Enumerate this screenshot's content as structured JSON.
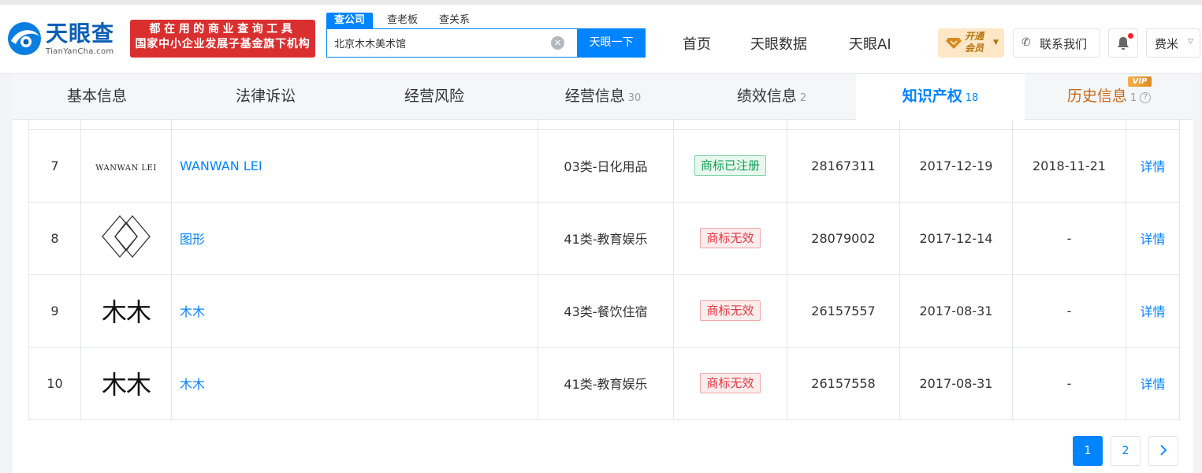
{
  "header": {
    "logo_cn": "天眼查",
    "logo_en": "TianYanCha.com",
    "slogan_line1": "都在用的商业查询工具",
    "slogan_line2": "国家中小企业发展子基金旗下机构",
    "search_tabs": [
      "查公司",
      "查老板",
      "查关系"
    ],
    "search_value": "北京木木美术馆",
    "search_button": "天眼一下",
    "nav": [
      "首页",
      "天眼数据",
      "天眼AI"
    ],
    "vip_line1": "开通",
    "vip_line2": "会员",
    "contact_label": "联系我们",
    "user_label": "费米",
    "colors": {
      "accent": "#0084ff",
      "slogan_bg": "#d9302f",
      "vip_bg": "#fde7c6"
    }
  },
  "tabs": [
    {
      "label": "基本信息",
      "count": ""
    },
    {
      "label": "法律诉讼",
      "count": ""
    },
    {
      "label": "经营风险",
      "count": ""
    },
    {
      "label": "经营信息",
      "count": "30"
    },
    {
      "label": "绩效信息",
      "count": "2"
    },
    {
      "label": "知识产权",
      "count": "18",
      "active": true
    },
    {
      "label": "历史信息",
      "count": "1",
      "badge": "VIP"
    }
  ],
  "trademarks": [
    {
      "num": "7",
      "image_text": "WANWAN LEI",
      "name": "WANWAN LEI",
      "category": "03类-日化用品",
      "status": "商标已注册",
      "status_type": "ok",
      "reg_no": "28167311",
      "apply_date": "2017-12-19",
      "reg_date": "2018-11-21",
      "action": "详情"
    },
    {
      "num": "8",
      "image_text": "",
      "name": "图形",
      "category": "41类-教育娱乐",
      "status": "商标无效",
      "status_type": "bad",
      "reg_no": "28079002",
      "apply_date": "2017-12-14",
      "reg_date": "-",
      "action": "详情"
    },
    {
      "num": "9",
      "image_text": "木木",
      "name": "木木",
      "category": "43类-餐饮住宿",
      "status": "商标无效",
      "status_type": "bad",
      "reg_no": "26157557",
      "apply_date": "2017-08-31",
      "reg_date": "-",
      "action": "详情"
    },
    {
      "num": "10",
      "image_text": "木木",
      "name": "木木",
      "category": "41类-教育娱乐",
      "status": "商标无效",
      "status_type": "bad",
      "reg_no": "26157558",
      "apply_date": "2017-08-31",
      "reg_date": "-",
      "action": "详情"
    }
  ],
  "pagination": {
    "pages": [
      "1",
      "2"
    ],
    "current": "1",
    "next_icon": "chevron-right-icon"
  }
}
